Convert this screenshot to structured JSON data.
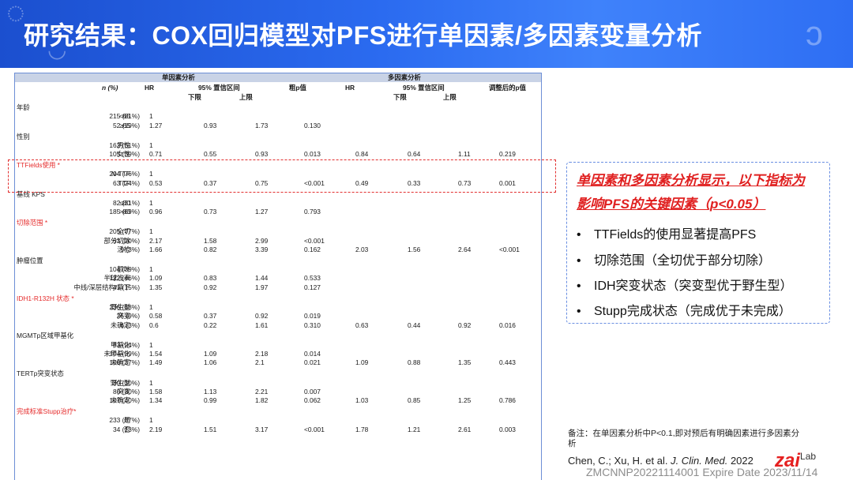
{
  "header": {
    "title": "研究结果：COX回归模型对PFS进行单因素/多因素变量分析",
    "bg_color": "#2b6bf0"
  },
  "table": {
    "group_uni": "单因素分析",
    "group_multi": "多因素分析",
    "col_n": "n (%)",
    "col_hr": "HR",
    "col_ci": "95% 置信区间",
    "col_lower": "下限",
    "col_upper": "上限",
    "col_p_raw": "粗p值",
    "col_hr2": "HR",
    "col_ci2": "95% 置信区间",
    "col_lower2": "下限",
    "col_upper2": "上限",
    "col_p_adj": "调整后的p值",
    "sections": [
      {
        "title": "年龄",
        "red": false,
        "rows": [
          {
            "label": "<65",
            "n": "215 (81%)",
            "hr1": "1",
            "lo1": "",
            "up1": "",
            "p1": "",
            "hr2": "",
            "lo2": "",
            "up2": "",
            "p2": ""
          },
          {
            "label": "≥65",
            "n": "52 (19%)",
            "hr1": "1.27",
            "lo1": "0.93",
            "up1": "1.73",
            "p1": "0.130",
            "hr2": "",
            "lo2": "",
            "up2": "",
            "p2": ""
          }
        ]
      },
      {
        "title": "性别",
        "red": false,
        "rows": [
          {
            "label": "男性",
            "n": "162 (61%)",
            "hr1": "1",
            "lo1": "",
            "up1": "",
            "p1": "",
            "hr2": "",
            "lo2": "",
            "up2": "",
            "p2": ""
          },
          {
            "label": "女性",
            "n": "105 (39%)",
            "hr1": "0.71",
            "lo1": "0.55",
            "up1": "0.93",
            "p1": "0.013",
            "hr2": "0.84",
            "lo2": "0.64",
            "up2": "1.11",
            "p2": "0.219"
          }
        ]
      },
      {
        "title": "TTFields使用 *",
        "red": true,
        "rows": [
          {
            "label": "N-TTF",
            "n": "204 (76%)",
            "hr1": "1",
            "lo1": "",
            "up1": "",
            "p1": "",
            "hr2": "",
            "lo2": "",
            "up2": "",
            "p2": ""
          },
          {
            "label": "TTF",
            "n": "63 (24%)",
            "hr1": "0.53",
            "lo1": "0.37",
            "up1": "0.75",
            "p1": "<0.001",
            "hr2": "0.49",
            "lo2": "0.33",
            "up2": "0.73",
            "p2": "0.001"
          }
        ]
      },
      {
        "title": "基线 KPS",
        "red": false,
        "rows": [
          {
            "label": "≤80",
            "n": "82 (31%)",
            "hr1": "1",
            "lo1": "",
            "up1": "",
            "p1": "",
            "hr2": "",
            "lo2": "",
            "up2": "",
            "p2": ""
          },
          {
            "label": ">80",
            "n": "185 (69%)",
            "hr1": "0.96",
            "lo1": "0.73",
            "up1": "1.27",
            "p1": "0.793",
            "hr2": "",
            "lo2": "",
            "up2": "",
            "p2": ""
          }
        ]
      },
      {
        "title": "切除范围 *",
        "red": true,
        "rows": [
          {
            "label": "全切",
            "n": "205 (77%)",
            "hr1": "1",
            "lo1": "",
            "up1": "",
            "p1": "",
            "hr2": "",
            "lo2": "",
            "up2": "",
            "p2": ""
          },
          {
            "label": "部分切除",
            "n": "53 (20%)",
            "hr1": "2.17",
            "lo1": "1.58",
            "up1": "2.99",
            "p1": "<0.001",
            "hr2": "",
            "lo2": "",
            "up2": "",
            "p2": ""
          },
          {
            "label": "活检",
            "n": "9 (3%)",
            "hr1": "1.66",
            "lo1": "0.82",
            "up1": "3.39",
            "p1": "0.162",
            "hr2": "2.03",
            "lo2": "1.56",
            "up2": "2.64",
            "p2": "<0.001"
          }
        ]
      },
      {
        "title": "肿瘤位置",
        "red": false,
        "rows": [
          {
            "label": "额叶",
            "n": "104 (39%)",
            "hr1": "1",
            "lo1": "",
            "up1": "",
            "p1": "",
            "hr2": "",
            "lo2": "",
            "up2": "",
            "p2": ""
          },
          {
            "label": "半球浅表",
            "n": "122 (46%)",
            "hr1": "1.09",
            "lo1": "0.83",
            "up1": "1.44",
            "p1": "0.533",
            "hr2": "",
            "lo2": "",
            "up2": "",
            "p2": ""
          },
          {
            "label": "中线/深层结构/幕下",
            "n": "41 (15%)",
            "hr1": "1.35",
            "lo1": "0.92",
            "up1": "1.97",
            "p1": "0.127",
            "hr2": "",
            "lo2": "",
            "up2": "",
            "p2": ""
          }
        ]
      },
      {
        "title": "IDH1-R132H 状态 *",
        "red": true,
        "rows": [
          {
            "label": "野生型",
            "n": "236 (88%)",
            "hr1": "1",
            "lo1": "",
            "up1": "",
            "p1": "",
            "hr2": "",
            "lo2": "",
            "up2": "",
            "p2": ""
          },
          {
            "label": "突变",
            "n": "25 (9%)",
            "hr1": "0.58",
            "lo1": "0.37",
            "up1": "0.92",
            "p1": "0.019",
            "hr2": "",
            "lo2": "",
            "up2": "",
            "p2": ""
          },
          {
            "label": "未确定",
            "n": "6 (3%)",
            "hr1": "0.6",
            "lo1": "0.22",
            "up1": "1.61",
            "p1": "0.310",
            "hr2": "0.63",
            "lo2": "0.44",
            "up2": "0.92",
            "p2": "0.016"
          }
        ]
      },
      {
        "title": "MGMTp区域甲基化",
        "red": false,
        "rows": [
          {
            "label": "甲基化",
            "n": "63 (24%)",
            "hr1": "1",
            "lo1": "",
            "up1": "",
            "p1": "",
            "hr2": "",
            "lo2": "",
            "up2": "",
            "p2": ""
          },
          {
            "label": "未甲基化",
            "n": "104 (39%)",
            "hr1": "1.54",
            "lo1": "1.09",
            "up1": "2.18",
            "p1": "0.014",
            "hr2": "",
            "lo2": "",
            "up2": "",
            "p2": ""
          },
          {
            "label": "未确定",
            "n": "100 (37%)",
            "hr1": "1.49",
            "lo1": "1.06",
            "up1": "2.1",
            "p1": "0.021",
            "hr2": "1.09",
            "lo2": "0.88",
            "up2": "1.35",
            "p2": "0.443"
          }
        ]
      },
      {
        "title": "TERTp突变状态",
        "red": false,
        "rows": [
          {
            "label": "野生型",
            "n": "80 (30%)",
            "hr1": "1",
            "lo1": "",
            "up1": "",
            "p1": "",
            "hr2": "",
            "lo2": "",
            "up2": "",
            "p2": ""
          },
          {
            "label": "突变",
            "n": "80 (30%)",
            "hr1": "1.58",
            "lo1": "1.13",
            "up1": "2.21",
            "p1": "0.007",
            "hr2": "",
            "lo2": "",
            "up2": "",
            "p2": ""
          },
          {
            "label": "未确定",
            "n": "107 (40%)",
            "hr1": "1.34",
            "lo1": "0.99",
            "up1": "1.82",
            "p1": "0.062",
            "hr2": "1.03",
            "lo2": "0.85",
            "up2": "1.25",
            "p2": "0.786"
          }
        ]
      },
      {
        "title": "完成标准Stupp治疗*",
        "red": true,
        "rows": [
          {
            "label": "是",
            "n": "233 (87%)",
            "hr1": "1",
            "lo1": "",
            "up1": "",
            "p1": "",
            "hr2": "",
            "lo2": "",
            "up2": "",
            "p2": ""
          },
          {
            "label": "否",
            "n": "34 (13%)",
            "hr1": "2.19",
            "lo1": "1.51",
            "up1": "3.17",
            "p1": "<0.001",
            "hr2": "1.78",
            "lo2": "1.21",
            "up2": "2.61",
            "p2": "0.003"
          }
        ]
      }
    ]
  },
  "callout": {
    "heading_line1": "单因素和多因素分析显示，以下指标为",
    "heading_line2": "影响PFS的关键因素（p<0.05）",
    "bullet_char": "•",
    "bullets": [
      "TTFields的使用显著提高PFS",
      "切除范围（全切优于部分切除）",
      "IDH突变状态（突变型优于野生型）",
      "Stupp完成状态（完成优于未完成）"
    ],
    "accent_color": "#e02020"
  },
  "footer": {
    "note": "备注：在单因素分析中P<0.1,即对预后有明确因素进行多因素分析",
    "cite_authors": "Chen, C.; Xu, H. et al.",
    "cite_journal": "J. Clin. Med.",
    "cite_year": "2022",
    "logo_main": "zai",
    "logo_sub": "Lab",
    "watermark": "ZMCNNP20221114001 Expire Date 2023/11/14"
  }
}
